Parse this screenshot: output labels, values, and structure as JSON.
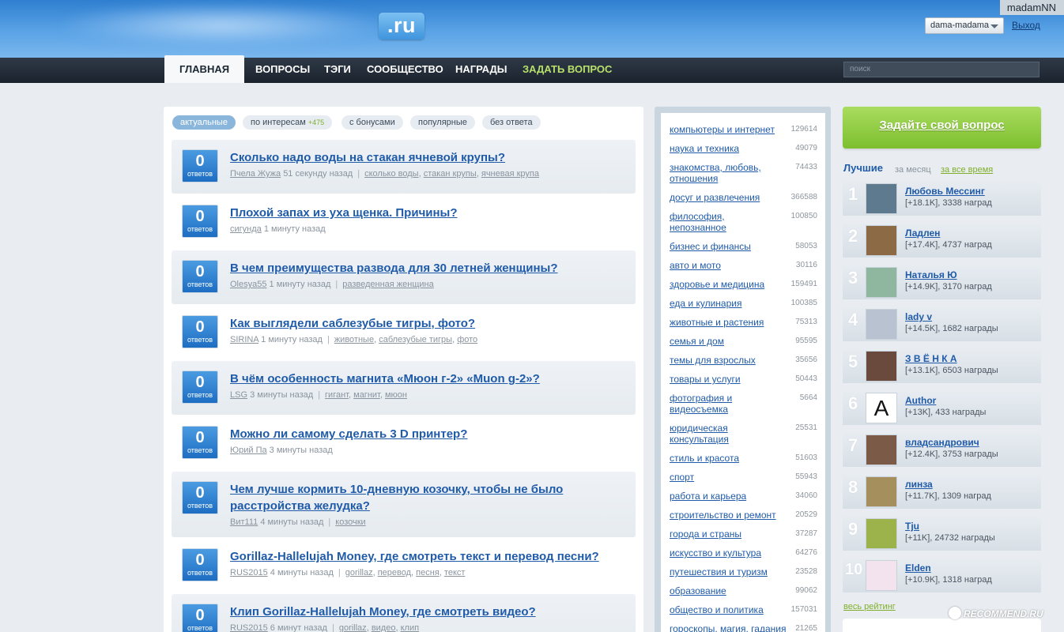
{
  "header": {
    "logo_suffix": ".ru",
    "username": "madamNN",
    "user_menu": "dama-madama",
    "logout": "Выход"
  },
  "nav": {
    "tabs": [
      {
        "label": "ГЛАВНАЯ"
      },
      {
        "label": "ВОПРОСЫ"
      },
      {
        "label": "ТЭГИ"
      },
      {
        "label": "СООБЩЕСТВО"
      },
      {
        "label": "НАГРАДЫ"
      },
      {
        "label": "ЗАДАТЬ ВОПРОС"
      }
    ],
    "search_placeholder": "поиск"
  },
  "filters": [
    {
      "label": "актуальные"
    },
    {
      "label": "по интересам",
      "count": "+475"
    },
    {
      "label": "с бонусами"
    },
    {
      "label": "популярные"
    },
    {
      "label": "без ответа"
    }
  ],
  "answers_label": "ответов",
  "questions": [
    {
      "answers": "0",
      "title": "Сколько надо воды на стакан ячневой крупы?",
      "author": "Пчела Жужа",
      "time": "51 секунду назад",
      "tags": [
        "сколько воды",
        "стакан крупы",
        "ячневая крупа"
      ]
    },
    {
      "answers": "0",
      "title": "Плохой запах из уха щенка. Причины?",
      "author": "сигунда",
      "time": "1 минуту назад",
      "tags": []
    },
    {
      "answers": "0",
      "title": "В чем преимущества развода для 30 летней женщины?",
      "author": "Olesya55",
      "time": "1 минуту назад",
      "tags": [
        "разведенная женщина"
      ]
    },
    {
      "answers": "0",
      "title": "Как выглядели саблезубые тигры, фото?",
      "author": "SIRINA",
      "time": "1 минуту назад",
      "tags": [
        "животные",
        "саблезубые тигры",
        "фото"
      ]
    },
    {
      "answers": "0",
      "title": "В чём особенность магнита «Мюон г-2» «Muon g-2»?",
      "author": "LSG",
      "time": "3 минуты назад",
      "tags": [
        "гигант",
        "магнит",
        "мюон"
      ]
    },
    {
      "answers": "0",
      "title": "Можно ли самому сделать 3 D принтер?",
      "author": "Юрий Па",
      "time": "3 минуты назад",
      "tags": []
    },
    {
      "answers": "0",
      "title": "Чем лучше кормить 10-дневную козочку, чтобы не было расстройства желудка?",
      "author": "Вит111",
      "time": "4 минуты назад",
      "tags": [
        "козочки"
      ]
    },
    {
      "answers": "0",
      "title": "Gorillaz-Hallelujah Money, где смотреть текст и перевод песни?",
      "author": "RUS2015",
      "time": "4 минуты назад",
      "tags": [
        "gorillaz",
        "перевод",
        "песня",
        "текст"
      ]
    },
    {
      "answers": "0",
      "title": "Клип Gorillaz-Hallelujah Money, где смотреть видео?",
      "author": "RUS2015",
      "time": "6 минут назад",
      "tags": [
        "gorillaz",
        "видео",
        "клип"
      ]
    }
  ],
  "categories": [
    {
      "name": "компьютеры и интернет",
      "count": "129614"
    },
    {
      "name": "наука и техника",
      "count": "49079"
    },
    {
      "name": "знакомства, любовь, отношения",
      "count": "74433"
    },
    {
      "name": "досуг и развлечения",
      "count": "366588"
    },
    {
      "name": "философия, непознанное",
      "count": "100850"
    },
    {
      "name": "бизнес и финансы",
      "count": "58053"
    },
    {
      "name": "авто и мото",
      "count": "30116"
    },
    {
      "name": "здоровье и медицина",
      "count": "159491"
    },
    {
      "name": "еда и кулинария",
      "count": "100385"
    },
    {
      "name": "животные и растения",
      "count": "75313"
    },
    {
      "name": "семья и дом",
      "count": "95595"
    },
    {
      "name": "темы для взрослых",
      "count": "35656"
    },
    {
      "name": "товары и услуги",
      "count": "50443"
    },
    {
      "name": "фотография и видеосъемка",
      "count": "5664"
    },
    {
      "name": "юридическая консультация",
      "count": "25531"
    },
    {
      "name": "стиль и красота",
      "count": "51603"
    },
    {
      "name": "спорт",
      "count": "55943"
    },
    {
      "name": "работа и карьера",
      "count": "34060"
    },
    {
      "name": "строительство и ремонт",
      "count": "20529"
    },
    {
      "name": "города и страны",
      "count": "37287"
    },
    {
      "name": "искусство и культура",
      "count": "64276"
    },
    {
      "name": "путешествия и туризм",
      "count": "23528"
    },
    {
      "name": "образование",
      "count": "99062"
    },
    {
      "name": "общество и политика",
      "count": "157031"
    },
    {
      "name": "гороскопы, магия, гадания",
      "count": "21265"
    }
  ],
  "sidebar": {
    "ask_button": "Задайте свой вопрос",
    "best_title": "Лучшие",
    "best_month": "за месяц",
    "best_all": "за все время",
    "all_rating": "весь рейтинг",
    "leaders": [
      {
        "rank": "1",
        "name": "Любовь Мессинг",
        "stats": "[+18.1K], 3338 наград",
        "avatar": "#5d7a8f"
      },
      {
        "rank": "2",
        "name": "Ладлен",
        "stats": "[+17.4K], 4737 наград",
        "avatar": "#8c6a45"
      },
      {
        "rank": "3",
        "name": "Наталья Ю",
        "stats": "[+14.9K], 3170 наград",
        "avatar": "#8fb7a0"
      },
      {
        "rank": "4",
        "name": "lady v",
        "stats": "[+14.5K], 1682 награды",
        "avatar": "#b9c2d0"
      },
      {
        "rank": "5",
        "name": "З В Ё Н К А",
        "stats": "[+13.1K], 6503 награды",
        "avatar": "#6a4a3c"
      },
      {
        "rank": "6",
        "name": "Author",
        "stats": "[+13K], 433 награды",
        "avatar": "#ffffff",
        "letter": "A"
      },
      {
        "rank": "7",
        "name": "владсандрович",
        "stats": "[+12.4K], 3753 награды",
        "avatar": "#7c5a48"
      },
      {
        "rank": "8",
        "name": "линза",
        "stats": "[+11.7K], 1309 наград",
        "avatar": "#a58f5c"
      },
      {
        "rank": "9",
        "name": "Tju",
        "stats": "[+11K], 24732 награды",
        "avatar": "#9bb34a"
      },
      {
        "rank": "10",
        "name": "Elden",
        "stats": "[+10.9K], 1318 наград",
        "avatar": "#f3e3ee"
      }
    ]
  },
  "watermark": "RECOMMEND.RU",
  "colors": {
    "link": "#1f5ba8",
    "accent_green": "#7fae2a",
    "nav_bg": "#1a222c",
    "header_blue": "#3e8ad6"
  }
}
